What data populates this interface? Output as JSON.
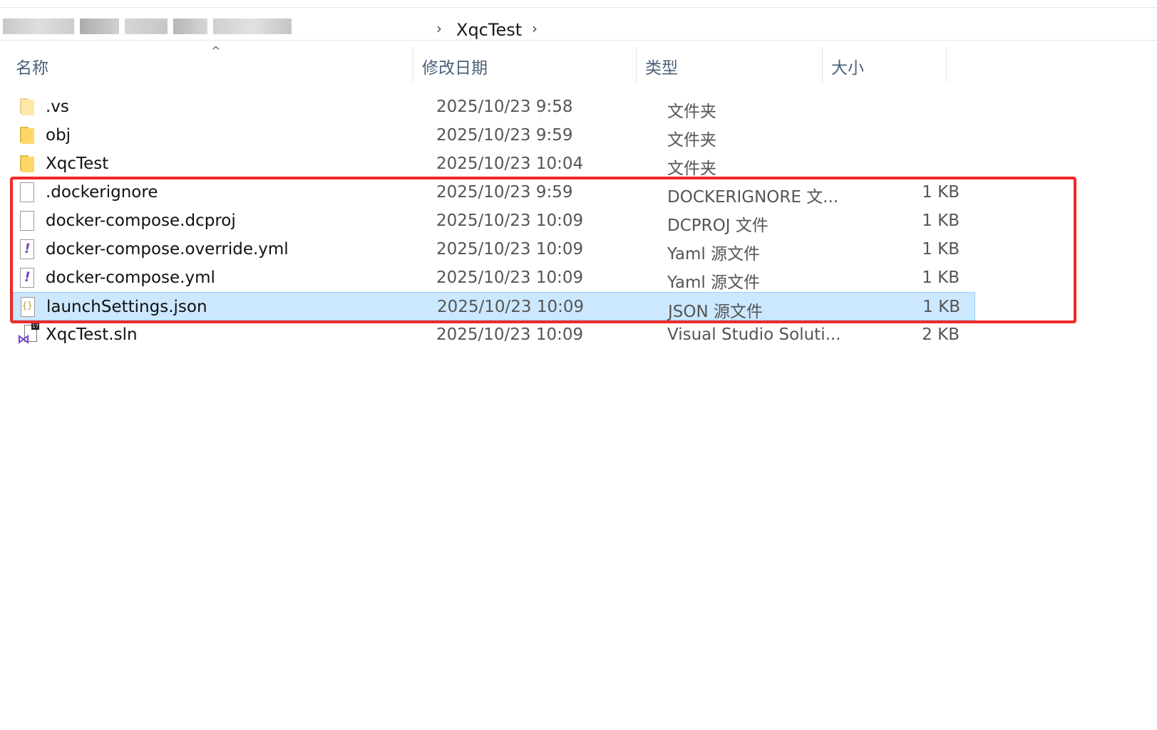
{
  "breadcrumb": {
    "current": "XqcTest",
    "separator": "›"
  },
  "columns": {
    "name": "名称",
    "date": "修改日期",
    "type": "类型",
    "size": "大小"
  },
  "sort": {
    "column": "name",
    "direction": "ascending",
    "indicator": "^"
  },
  "files": [
    {
      "name": ".vs",
      "date": "2025/10/23 9:58",
      "type": "文件夹",
      "size": "",
      "icon": "folder-icon"
    },
    {
      "name": "obj",
      "date": "2025/10/23 9:59",
      "type": "文件夹",
      "size": "",
      "icon": "folder-icon"
    },
    {
      "name": "XqcTest",
      "date": "2025/10/23 10:04",
      "type": "文件夹",
      "size": "",
      "icon": "folder-icon"
    },
    {
      "name": ".dockerignore",
      "date": "2025/10/23 9:59",
      "type": "DOCKERIGNORE 文...",
      "size": "1 KB",
      "icon": "generic-file-icon"
    },
    {
      "name": "docker-compose.dcproj",
      "date": "2025/10/23 10:09",
      "type": "DCPROJ 文件",
      "size": "1 KB",
      "icon": "generic-file-icon"
    },
    {
      "name": "docker-compose.override.yml",
      "date": "2025/10/23 10:09",
      "type": "Yaml 源文件",
      "size": "1 KB",
      "icon": "yaml-file-icon"
    },
    {
      "name": "docker-compose.yml",
      "date": "2025/10/23 10:09",
      "type": "Yaml 源文件",
      "size": "1 KB",
      "icon": "yaml-file-icon"
    },
    {
      "name": "launchSettings.json",
      "date": "2025/10/23 10:09",
      "type": "JSON 源文件",
      "size": "1 KB",
      "icon": "json-file-icon",
      "selected": true
    },
    {
      "name": "XqcTest.sln",
      "date": "2025/10/23 10:09",
      "type": "Visual Studio Soluti...",
      "size": "2 KB",
      "icon": "vs-solution-icon"
    }
  ],
  "icon_glyphs": {
    "yaml": "!",
    "json": "{}",
    "sln_badge": "17",
    "sln_logo": "⋈"
  },
  "colors": {
    "selection": "#cce8ff",
    "highlight_border": "#f22929",
    "header_text": "#4c607a",
    "folder": "#ffd767"
  }
}
